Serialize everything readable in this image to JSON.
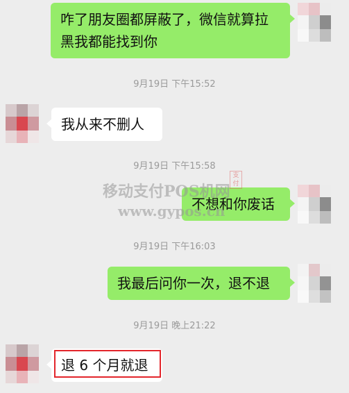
{
  "messages": [
    {
      "dir": "out",
      "lines": [
        "咋了朋友圈都屏蔽了，微信就算拉",
        "黑我都能找到你"
      ]
    },
    {
      "dir": "time",
      "text": "9月19日 下午15:52"
    },
    {
      "dir": "in",
      "lines": [
        "我从来不删人"
      ]
    },
    {
      "dir": "time",
      "text": "9月19日 下午15:58"
    },
    {
      "dir": "out",
      "lines": [
        "不想和你废话"
      ]
    },
    {
      "dir": "time",
      "text": "9月19日 下午16:03"
    },
    {
      "dir": "out",
      "lines": [
        "我最后问你一次，退不退"
      ]
    },
    {
      "dir": "time",
      "text": "9月19日 晚上21:22"
    },
    {
      "dir": "in",
      "lines": [
        "退 6 个月就退"
      ]
    }
  ],
  "watermark": {
    "line1": "移动支付POS机网",
    "line2": "www.gypos.cn",
    "stamp": "支付"
  },
  "colors": {
    "background": "#ededed",
    "outgoing_bubble": "#95ec69",
    "incoming_bubble": "#ffffff",
    "highlight": "#e3252b",
    "timestamp": "#9a9a9a"
  }
}
